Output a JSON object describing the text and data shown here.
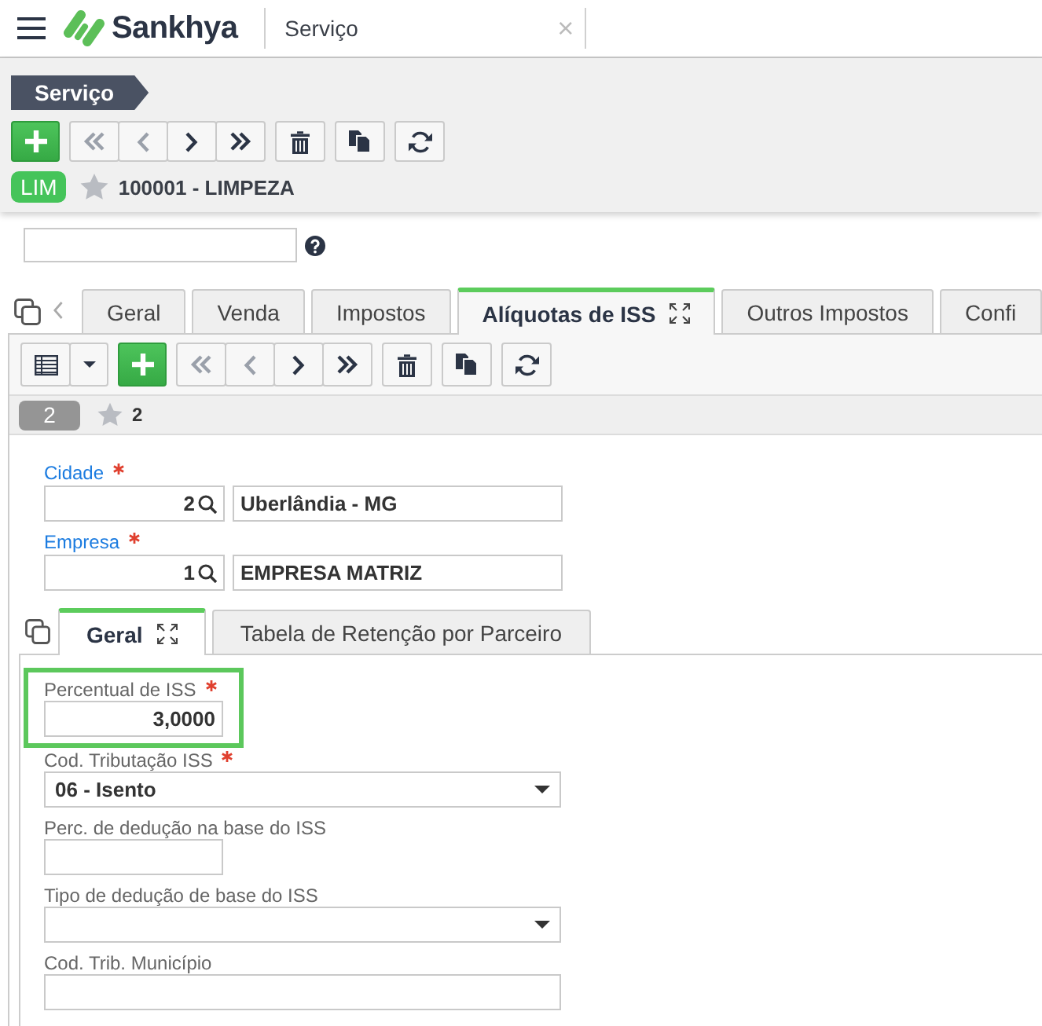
{
  "app_bar": {
    "brand": "Sankhya",
    "tab": {
      "title": "Serviço",
      "close": "×"
    }
  },
  "header": {
    "breadcrumb": "Serviço",
    "toolbar": [
      {
        "buttons": [
          {
            "kind": "add",
            "disabled": false
          }
        ]
      },
      {
        "buttons": [
          {
            "kind": "first",
            "disabled": true
          },
          {
            "kind": "previous",
            "disabled": true
          },
          {
            "kind": "next",
            "disabled": false
          },
          {
            "kind": "last",
            "disabled": false
          }
        ]
      },
      {
        "buttons": [
          {
            "kind": "delete",
            "disabled": false
          }
        ]
      },
      {
        "buttons": [
          {
            "kind": "duplicate",
            "disabled": false
          }
        ]
      },
      {
        "buttons": [
          {
            "kind": "refresh",
            "disabled": false
          }
        ]
      }
    ],
    "record": {
      "badge": "LIM",
      "favorite": false,
      "title": "100001 - LIMPEZA"
    }
  },
  "top_form": {
    "fields": [
      {
        "kind": "text",
        "help": true
      }
    ]
  },
  "tabs": [
    {
      "label": "Geral",
      "selected": false
    },
    {
      "label": "Venda",
      "selected": false
    },
    {
      "label": "Impostos",
      "selected": false
    },
    {
      "label": "Alíquotas de ISS",
      "selected": true
    },
    {
      "label": "Outros Impostos",
      "selected": false
    },
    {
      "label": "Confi",
      "selected": false
    }
  ],
  "tab_panel": {
    "toolbar": [
      {
        "buttons": [
          {
            "kind": "grid",
            "disabled": false
          },
          {
            "kind": "menu",
            "disabled": false
          }
        ]
      },
      {
        "buttons": [
          {
            "kind": "add",
            "disabled": false
          }
        ]
      },
      {
        "buttons": [
          {
            "kind": "first",
            "disabled": true
          },
          {
            "kind": "previous",
            "disabled": true
          },
          {
            "kind": "next",
            "disabled": false
          },
          {
            "kind": "last",
            "disabled": false
          }
        ]
      },
      {
        "buttons": [
          {
            "kind": "delete",
            "disabled": false
          }
        ]
      },
      {
        "buttons": [
          {
            "kind": "duplicate",
            "disabled": false
          }
        ]
      },
      {
        "buttons": [
          {
            "kind": "refresh",
            "disabled": false
          }
        ]
      }
    ],
    "record": {
      "badge": "2",
      "favorite": false,
      "title": "2"
    },
    "lookups": [
      {
        "label": "Cidade",
        "required": true,
        "code": "2",
        "description": "Uberlândia - MG"
      },
      {
        "label": "Empresa",
        "required": true,
        "code": "1",
        "description": "EMPRESA MATRIZ"
      }
    ],
    "subtabs": [
      {
        "label": "Geral",
        "selected": true
      },
      {
        "label": "Tabela de Retenção por Parceiro",
        "selected": false
      }
    ],
    "fields": [
      {
        "kind": "number",
        "label": "Percentual de ISS",
        "required": true,
        "highlighted": true,
        "value": "3,0000"
      },
      {
        "kind": "select",
        "label": "Cod. Tributação ISS",
        "required": true,
        "highlighted": false,
        "value": "06 - Isento"
      },
      {
        "kind": "number",
        "label": "Perc. de dedução na base do ISS",
        "required": false,
        "highlighted": false
      },
      {
        "kind": "select",
        "label": "Tipo de dedução de base do ISS",
        "required": false,
        "highlighted": false
      },
      {
        "kind": "text",
        "label": "Cod. Trib. Município",
        "required": false,
        "highlighted": false
      }
    ]
  }
}
